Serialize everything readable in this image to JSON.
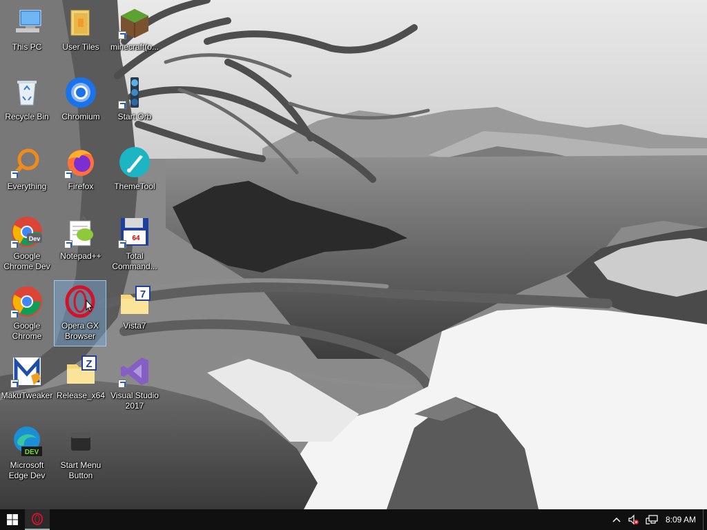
{
  "desktop": {
    "icons": [
      {
        "label": "This PC",
        "icon": "this-pc-icon"
      },
      {
        "label": "User Tiles",
        "icon": "folder-icon"
      },
      {
        "label": "minecraft(o...",
        "icon": "minecraft-icon"
      },
      {
        "label": "Recycle Bin",
        "icon": "recycle-bin-icon"
      },
      {
        "label": "Chromium",
        "icon": "chromium-icon"
      },
      {
        "label": "Start Orb",
        "icon": "start-orb-icon"
      },
      {
        "label": "Everything",
        "icon": "everything-icon"
      },
      {
        "label": "Firefox",
        "icon": "firefox-icon"
      },
      {
        "label": "ThemeTool",
        "icon": "themetool-icon"
      },
      {
        "label": "Google Chrome Dev",
        "icon": "chrome-dev-icon"
      },
      {
        "label": "Notepad++",
        "icon": "notepadpp-icon"
      },
      {
        "label": "Total Command...",
        "icon": "total-commander-icon"
      },
      {
        "label": "Google Chrome",
        "icon": "chrome-icon"
      },
      {
        "label": "Opera GX Browser",
        "icon": "opera-gx-icon"
      },
      {
        "label": "Vista7",
        "icon": "vista7-folder-icon"
      },
      {
        "label": "MakuTweaker",
        "icon": "makutweaker-icon"
      },
      {
        "label": "Release_x64",
        "icon": "release-folder-icon"
      },
      {
        "label": "Visual Studio 2017",
        "icon": "visual-studio-icon"
      },
      {
        "label": "Microsoft Edge Dev",
        "icon": "edge-dev-icon"
      },
      {
        "label": "Start Menu Button",
        "icon": "start-menu-button-icon"
      }
    ]
  },
  "taskbar": {
    "start_icon": "windows-logo-icon",
    "pinned_app_icon": "opera-gx-icon",
    "tray": {
      "chevron_icon": "chevron-up-icon",
      "volume_icon": "volume-muted-icon",
      "network_icon": "network-icon",
      "clock": "8:09 AM"
    }
  },
  "colors": {
    "taskbar_bg": "#101010",
    "selection": "#78aadc",
    "opera_red": "#d2142a"
  }
}
